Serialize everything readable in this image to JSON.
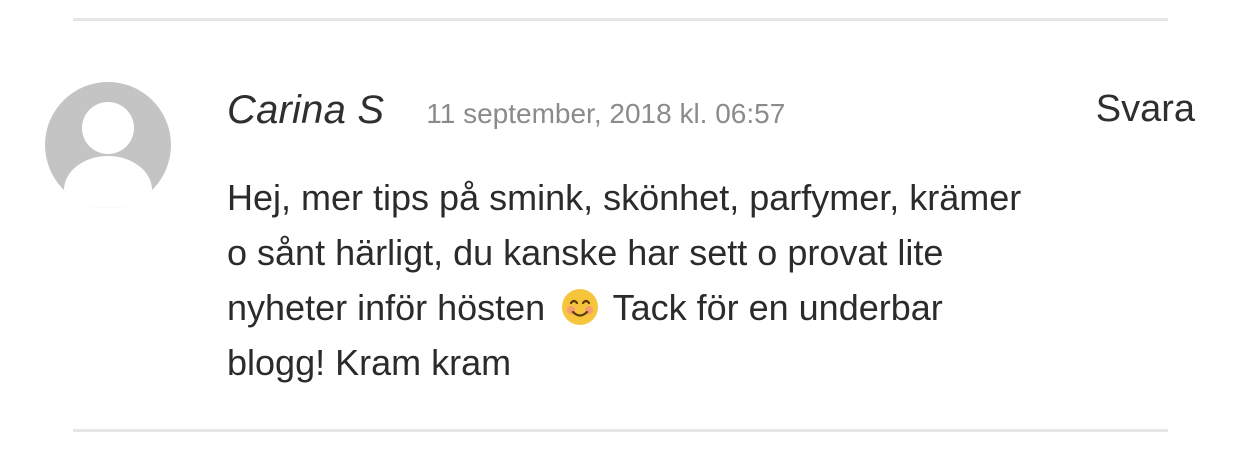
{
  "comment": {
    "author": "Carina S",
    "date": "11 september, 2018 kl. 06:57",
    "reply_label": "Svara",
    "lines": [
      "Hej, mer tips på smink, skönhet, parfymer, krämer",
      "o sånt härligt, du kanske har sett o provat lite",
      "nyheter inför hösten",
      "Tack för en underbar",
      "blogg! Kram kram"
    ],
    "emoji_name": "smiling-face-icon"
  },
  "colors": {
    "divider": "#e6e6e6",
    "avatar_bg": "#c4c4c4",
    "date_text": "#8b8b8b"
  }
}
